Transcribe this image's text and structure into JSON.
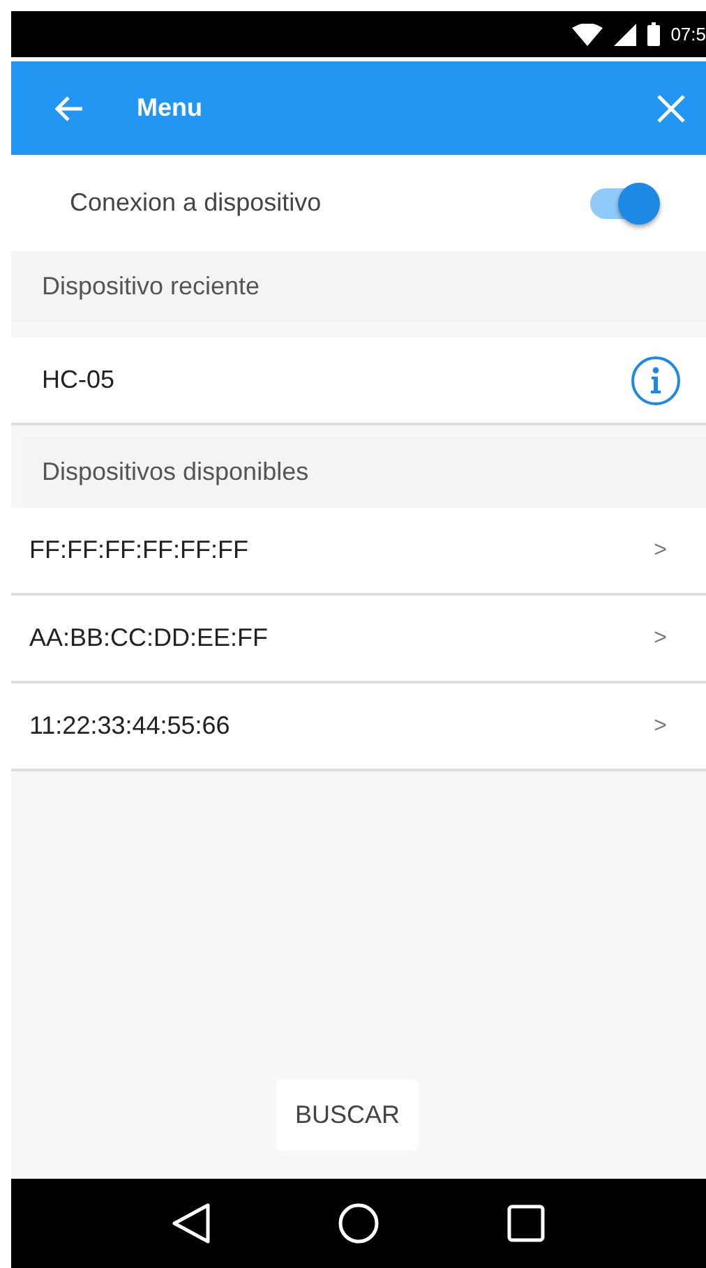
{
  "status_bar": {
    "time": "07:5"
  },
  "app_bar": {
    "title": "Menu"
  },
  "connection": {
    "label": "Conexion a dispositivo",
    "on": true
  },
  "recent": {
    "header": "Dispositivo reciente",
    "device": "HC-05"
  },
  "available": {
    "header": "Dispositivos disponibles",
    "devices": [
      {
        "address": "FF:FF:FF:FF:FF:FF",
        "chevron": ">"
      },
      {
        "address": "AA:BB:CC:DD:EE:FF",
        "chevron": ">"
      },
      {
        "address": "11:22:33:44:55:66",
        "chevron": ">"
      }
    ]
  },
  "search_button": "BUSCAR"
}
